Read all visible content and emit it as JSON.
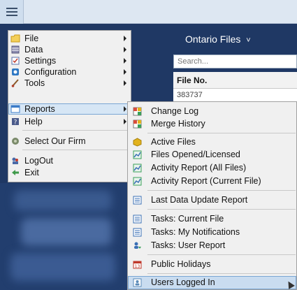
{
  "header": {
    "menu_icon": "hamburger-icon"
  },
  "main": {
    "title": "Ontario Files",
    "title_chevron": "˅",
    "search_placeholder": "Search...",
    "column_header": "File No.",
    "rows": [
      "383737"
    ]
  },
  "menu": {
    "items": [
      {
        "label": "File",
        "icon": "folder-icon",
        "icon_color": "#e8b830",
        "submenu": true
      },
      {
        "label": "Data",
        "icon": "database-icon",
        "icon_color": "#7a7aa0",
        "submenu": true
      },
      {
        "label": "Settings",
        "icon": "checklist-icon",
        "icon_color": "#5a6fa8",
        "submenu": true
      },
      {
        "label": "Configuration",
        "icon": "config-icon",
        "icon_color": "#2f78c4",
        "submenu": true
      },
      {
        "label": "Tools",
        "icon": "brush-icon",
        "icon_color": "#b0402a",
        "submenu": true
      },
      {
        "label": "Reports",
        "icon": "window-icon",
        "icon_color": "#3a7bc8",
        "submenu": true,
        "highlighted": true
      },
      {
        "label": "Help",
        "icon": "help-icon",
        "icon_color": "#4a5a8a",
        "submenu": true
      },
      {
        "label": "Select Our Firm",
        "icon": "firm-icon",
        "icon_color": "#6a7a5a",
        "submenu": false
      },
      {
        "label": "LogOut",
        "icon": "logout-icon",
        "icon_color": "#4a6aa8",
        "submenu": false
      },
      {
        "label": "Exit",
        "icon": "exit-icon",
        "icon_color": "#3f9a4a",
        "submenu": false
      }
    ]
  },
  "reports_submenu": {
    "items": [
      {
        "label": "Change Log",
        "icon": "grid-report-icon",
        "icon_color": "#d94c3c"
      },
      {
        "label": "Merge History",
        "icon": "grid-report-icon",
        "icon_color": "#d94c3c"
      },
      {
        "label": "Active Files",
        "icon": "active-files-icon",
        "icon_color": "#e2b21d"
      },
      {
        "label": "Files Opened/Licensed",
        "icon": "chart-icon",
        "icon_color": "#3aa05a"
      },
      {
        "label": "Activity Report (All Files)",
        "icon": "chart-icon",
        "icon_color": "#3aa05a"
      },
      {
        "label": "Activity Report (Current File)",
        "icon": "chart-icon",
        "icon_color": "#3aa05a"
      },
      {
        "label": "Last Data Update Report",
        "icon": "list-report-icon",
        "icon_color": "#3a6fb5"
      },
      {
        "label": "Tasks: Current File",
        "icon": "list-report-icon",
        "icon_color": "#3a6fb5"
      },
      {
        "label": "Tasks: My Notifications",
        "icon": "list-report-icon",
        "icon_color": "#3a6fb5"
      },
      {
        "label": "Tasks: User Report",
        "icon": "user-report-icon",
        "icon_color": "#3a6fb5"
      },
      {
        "label": "Public Holidays",
        "icon": "calendar-icon",
        "icon_color": "#c0392b"
      },
      {
        "label": "Users Logged In",
        "icon": "users-logged-in-icon",
        "icon_color": "#5a8ab8",
        "highlighted": true
      }
    ]
  }
}
